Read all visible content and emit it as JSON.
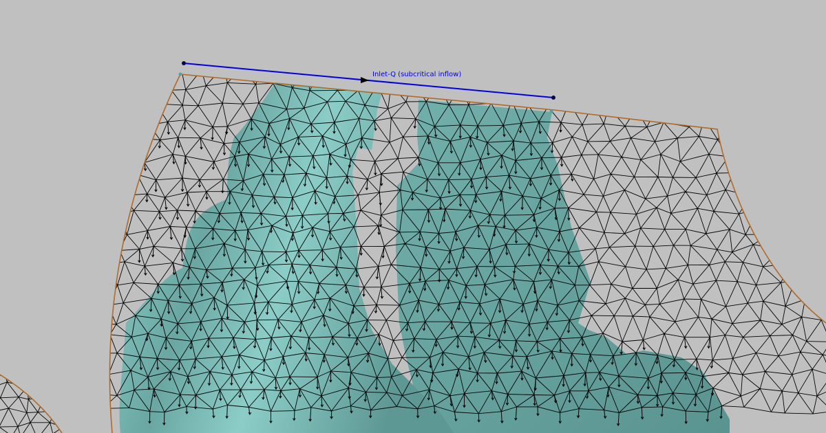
{
  "boundary_condition": {
    "label": "Inlet-Q (subcritical inflow)",
    "line_color": "#0000e0",
    "node_color": "#0a0a40"
  },
  "colors": {
    "background": "#c0c0c0",
    "mesh_edge": "#000000",
    "domain_boundary": "#b06a2a",
    "water_fill": "#6aa6a2",
    "water_highlight": "#8ed0cc",
    "velocity_arrow": "#000000"
  },
  "icons": [
    "velocity-arrow-icon",
    "node-marker-icon"
  ]
}
